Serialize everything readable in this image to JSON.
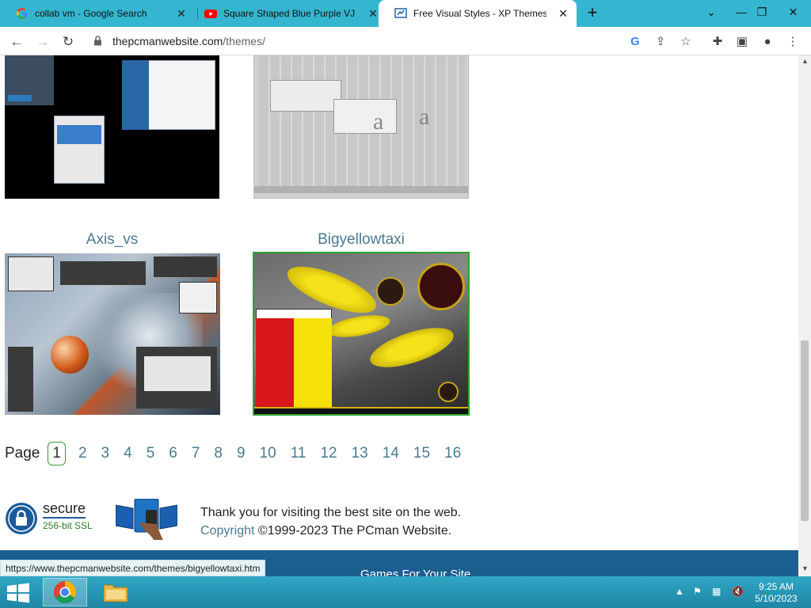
{
  "tabs": [
    {
      "title": "collab vm - Google Search",
      "icon": "google-icon",
      "active": false
    },
    {
      "title": "Square Shaped Blue Purple VJ Se",
      "icon": "youtube-icon",
      "active": false
    },
    {
      "title": "Free Visual Styles - XP Themes -",
      "icon": "site-icon",
      "active": true
    }
  ],
  "address": {
    "domain": "thepcmanwebsite.com",
    "path": "/themes/"
  },
  "themes": [
    {
      "title": "Axis_vs"
    },
    {
      "title": "Bigyellowtaxi"
    }
  ],
  "pagination": {
    "label": "Page",
    "current": "1",
    "pages": [
      "2",
      "3",
      "4",
      "5",
      "6",
      "7",
      "8",
      "9",
      "10",
      "11",
      "12",
      "13",
      "14",
      "15",
      "16"
    ]
  },
  "footer": {
    "secure": "secure",
    "ssl": "256-bit SSL",
    "thanks": "Thank you for visiting the best site on the web.",
    "copyright_link": "Copyright",
    "copyright_text": " ©1999-2023 The PCman Website.",
    "games": "Games For Your Site"
  },
  "status_bar_url": "https://www.thepcmanwebsite.com/themes/bigyellowtaxi.htm",
  "clock": {
    "time": "9:25 AM",
    "date": "5/10/2023"
  },
  "colors": {
    "tabstrip": "#35b6d0",
    "link": "#4a7a90",
    "taskbar": "#2fa7c5"
  }
}
